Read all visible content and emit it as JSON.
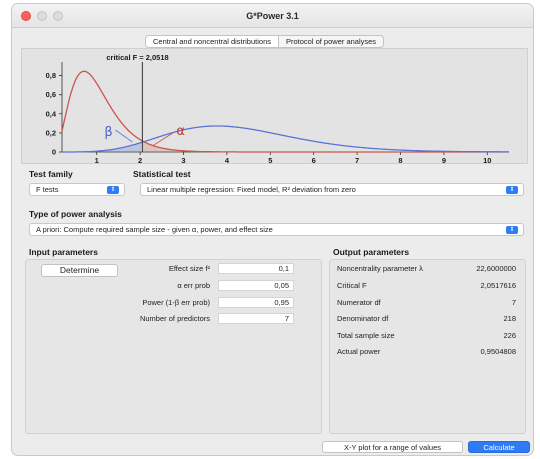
{
  "window": {
    "title": "G*Power 3.1"
  },
  "tabs": [
    {
      "label": "Central and noncentral distributions",
      "active": true
    },
    {
      "label": "Protocol of power analyses",
      "active": false
    }
  ],
  "plot": {
    "critical_label": "critical F = 2,0518",
    "critical_value": 2.0518,
    "beta_label": "β",
    "alpha_label": "α",
    "y_ticks": [
      "0,8",
      "0,6",
      "0,4",
      "0,2",
      "0"
    ],
    "x_ticks": [
      "1",
      "2",
      "3",
      "4",
      "5",
      "6",
      "7",
      "8",
      "9",
      "10"
    ],
    "central_color": "#c8574a",
    "noncentral_color": "#5b73d6",
    "noncentral_lambda": 22.6,
    "df1": 7,
    "df2": 218
  },
  "test_family": {
    "label": "Test family",
    "value": "F tests"
  },
  "statistical_test": {
    "label": "Statistical test",
    "value": "Linear multiple regression: Fixed model, R² deviation from zero"
  },
  "power_analysis": {
    "label": "Type of power analysis",
    "value": "A priori: Compute required sample size - given α, power, and effect size"
  },
  "input": {
    "title": "Input parameters",
    "determine_label": "Determine",
    "params": [
      {
        "label": "Effect size f²",
        "value": "0,1"
      },
      {
        "label": "α err prob",
        "value": "0,05"
      },
      {
        "label": "Power (1-β err prob)",
        "value": "0,95"
      },
      {
        "label": "Number of predictors",
        "value": "7"
      }
    ]
  },
  "output": {
    "title": "Output parameters",
    "params": [
      {
        "label": "Noncentrality parameter λ",
        "value": "22,6000000"
      },
      {
        "label": "Critical F",
        "value": "2,0517616"
      },
      {
        "label": "Numerator df",
        "value": "7"
      },
      {
        "label": "Denominator df",
        "value": "218"
      },
      {
        "label": "Total sample size",
        "value": "226"
      },
      {
        "label": "Actual power",
        "value": "0,9504808"
      }
    ]
  },
  "footer": {
    "xy_label": "X-Y plot for a range of values",
    "calculate_label": "Calculate"
  }
}
